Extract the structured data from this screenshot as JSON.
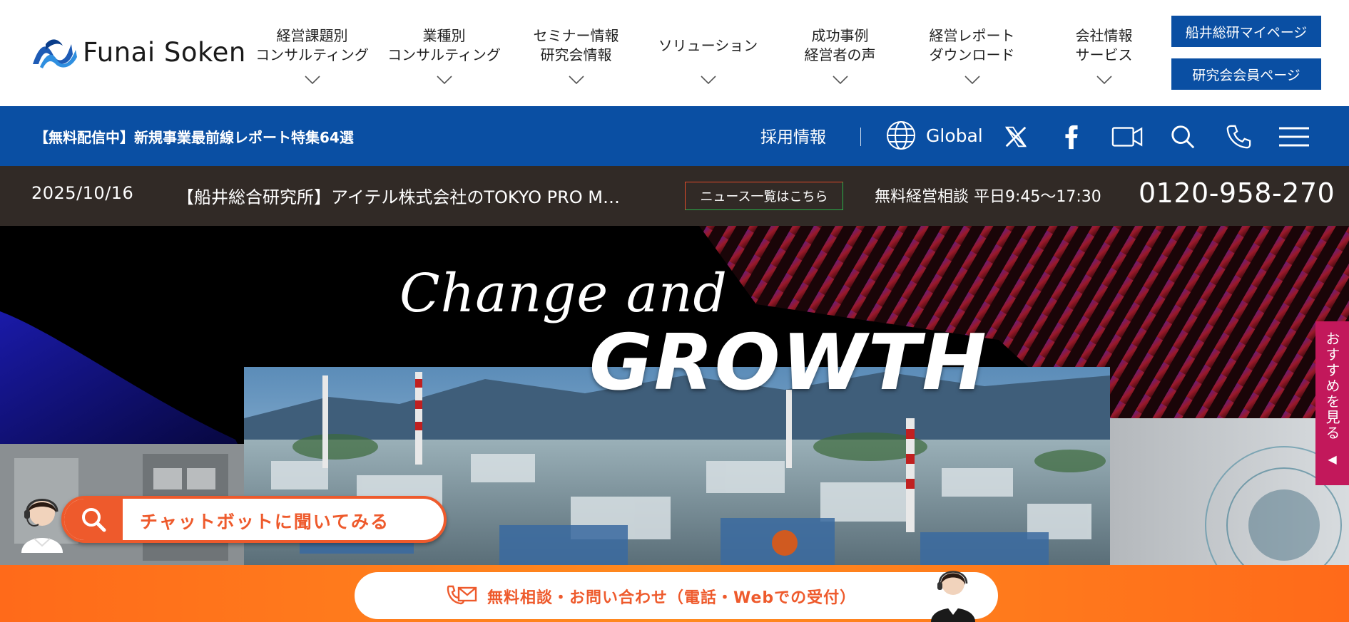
{
  "brand": {
    "logo_text": "Funai Soken"
  },
  "nav": [
    {
      "label": "経営課題別\nコンサルティング"
    },
    {
      "label": "業種別\nコンサルティング"
    },
    {
      "label": "セミナー情報\n研究会情報"
    },
    {
      "label": "ソリューション"
    },
    {
      "label": "成功事例\n経営者の声"
    },
    {
      "label": "経営レポート\nダウンロード"
    },
    {
      "label": "会社情報\nサービス"
    }
  ],
  "header_buttons": {
    "mypage": "船井総研マイページ",
    "member": "研究会会員ページ"
  },
  "bluebar": {
    "promo": "【無料配信中】新規事業最前線レポート特集64選",
    "recruit": "採用情報",
    "global": "Global",
    "icons": [
      "x-icon",
      "facebook-icon",
      "video-icon",
      "search-icon",
      "phone-icon",
      "menu-icon"
    ]
  },
  "news": {
    "date": "2025/10/16",
    "headline": "【船井総合研究所】アイテル株式会社のTOKYO PRO M…",
    "list_button": "ニュース一覧はこちら",
    "consult": "無料経営相談 平日9:45〜17:30",
    "phone": "0120-958-270"
  },
  "hero": {
    "script": "Change and",
    "title": "GROWTH"
  },
  "side_tab": {
    "label": "おすすめを見る",
    "arrow": "◀"
  },
  "chatbot": {
    "label": "チャットボットに聞いてみる"
  },
  "cta": {
    "label": "無料相談・お問い合わせ（電話・Webでの受付）"
  },
  "colors": {
    "primary": "#0a4fa3",
    "dark": "#312a26",
    "accent": "#ee5a2c",
    "pink": "#c2185b"
  }
}
